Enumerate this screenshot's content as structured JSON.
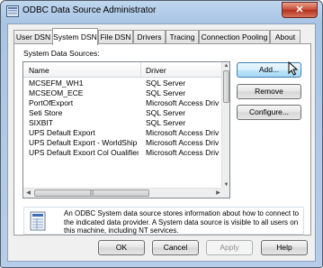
{
  "window": {
    "title": "ODBC Data Source Administrator",
    "close_label": "✕"
  },
  "tabs": [
    {
      "label": "User DSN",
      "active": false
    },
    {
      "label": "System DSN",
      "active": true
    },
    {
      "label": "File DSN",
      "active": false
    },
    {
      "label": "Drivers",
      "active": false
    },
    {
      "label": "Tracing",
      "active": false
    },
    {
      "label": "Connection Pooling",
      "active": false
    },
    {
      "label": "About",
      "active": false
    }
  ],
  "panel": {
    "section_label": "System Data Sources:",
    "columns": {
      "name": "Name",
      "driver": "Driver"
    },
    "rows": [
      {
        "name": "MCSEFM_WH1",
        "driver": "SQL Server"
      },
      {
        "name": "MCSEOM_ECE",
        "driver": "SQL Server"
      },
      {
        "name": "PortOfExport",
        "driver": "Microsoft Access Driv"
      },
      {
        "name": "Seti Store",
        "driver": "SQL Server"
      },
      {
        "name": "SIXBIT",
        "driver": "SQL Server"
      },
      {
        "name": "UPS Default Export",
        "driver": "Microsoft Access Driv"
      },
      {
        "name": "UPS Default Export - WorldShip",
        "driver": "Microsoft Access Driv"
      },
      {
        "name": "UPS Default Export Col Qualifier",
        "driver": "Microsoft Access Driv"
      }
    ]
  },
  "side_buttons": {
    "add": "Add...",
    "remove": "Remove",
    "configure": "Configure..."
  },
  "info": {
    "text": "An ODBC System data source stores information about how to connect to the indicated data provider.   A System data source is visible to all users on this machine, including NT services."
  },
  "footer_buttons": {
    "ok": "OK",
    "cancel": "Cancel",
    "apply": "Apply",
    "help": "Help"
  },
  "colors": {
    "title_bar": "#a9c5e5",
    "close_button": "#c7462f",
    "focus_border": "#3c7fb1"
  }
}
